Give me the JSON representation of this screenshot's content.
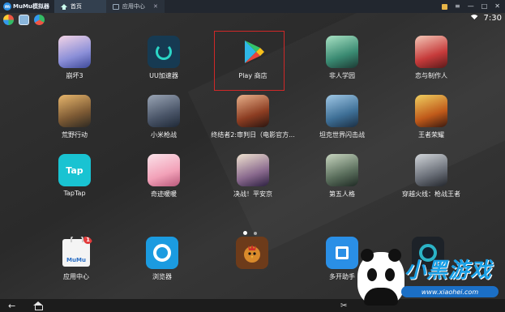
{
  "titlebar": {
    "brand": "MuMu模拟器",
    "tabs": [
      {
        "label": "首页",
        "active": true
      },
      {
        "label": "应用中心",
        "active": false
      }
    ],
    "close_glyph": "✕",
    "controls": [
      "≡",
      "—",
      "□",
      "✕"
    ]
  },
  "statusbar": {
    "time": "7:30"
  },
  "apps": [
    {
      "label": "崩坏3",
      "icon": "honkai3-icon"
    },
    {
      "label": "UU加速器",
      "icon": "uu-accelerator-icon"
    },
    {
      "label": "Play 商店",
      "icon": "play-store-icon"
    },
    {
      "label": "非人学园",
      "icon": "feiren-xueyuan-icon"
    },
    {
      "label": "恋与制作人",
      "icon": "love-producer-icon"
    },
    {
      "label": "荒野行动",
      "icon": "knives-out-icon"
    },
    {
      "label": "小米枪战",
      "icon": "xiaomi-gunfight-icon"
    },
    {
      "label": "终结者2:审判日（电影官方...",
      "icon": "terminator2-icon"
    },
    {
      "label": "坦克世界闪击战",
      "icon": "world-of-tanks-blitz-icon"
    },
    {
      "label": "王者荣耀",
      "icon": "honor-of-kings-icon"
    },
    {
      "label": "TapTap",
      "icon": "taptap-icon",
      "icon_text": "Tap"
    },
    {
      "label": "奇迹暖暖",
      "icon": "miracle-nikki-icon"
    },
    {
      "label": "决战！平安京",
      "icon": "onmyoji-arena-icon"
    },
    {
      "label": "第五人格",
      "icon": "identity-v-icon"
    },
    {
      "label": "穿越火线：枪战王者",
      "icon": "crossfire-icon"
    }
  ],
  "dock": [
    {
      "label": "应用中心",
      "icon": "app-center-icon",
      "badge": "1",
      "bag_text": "MuMu"
    },
    {
      "label": "浏览器",
      "icon": "browser-icon"
    },
    {
      "label": "",
      "icon": "rooster-game-icon"
    },
    {
      "label": "多开助手",
      "icon": "multi-instance-icon"
    },
    {
      "label": "",
      "icon": "camera-icon"
    }
  ],
  "watermark": {
    "text": "小黑游戏",
    "url": "www.xiaohei.com"
  },
  "colors": {
    "highlight_border": "#d02828",
    "titlebar_bg": "#22272f",
    "accent": "#2b8fe6"
  }
}
